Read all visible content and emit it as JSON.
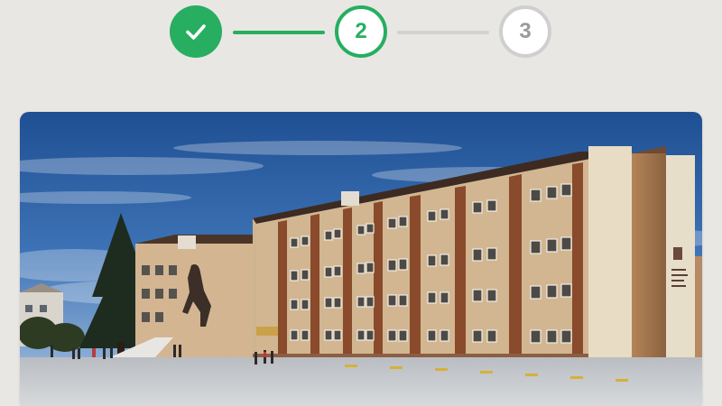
{
  "stepper": {
    "steps": [
      {
        "label": "",
        "state": "completed",
        "icon": "check-icon"
      },
      {
        "label": "2",
        "state": "active"
      },
      {
        "label": "3",
        "state": "inactive"
      }
    ]
  },
  "photo": {
    "subject": "school-building",
    "facade_text": "ANKARA ..."
  },
  "colors": {
    "accent": "#27ae60",
    "inactive": "#cfcfcf",
    "background": "#e9e7e3"
  }
}
